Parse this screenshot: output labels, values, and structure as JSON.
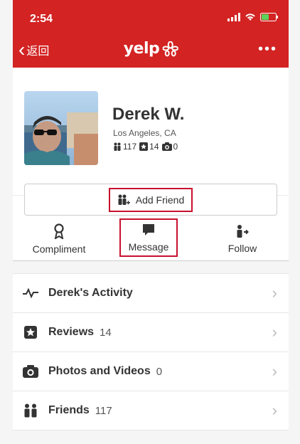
{
  "status": {
    "time": "2:54"
  },
  "nav": {
    "back_label": "返回",
    "logo_text": "yelp"
  },
  "profile": {
    "name": "Derek W.",
    "location": "Los Angeles, CA",
    "stats": {
      "friends": "117",
      "reviews": "14",
      "photos": "0"
    }
  },
  "actions": {
    "add_friend": "Add Friend",
    "compliment": "Compliment",
    "message": "Message",
    "follow": "Follow"
  },
  "list": [
    {
      "label": "Derek's Activity",
      "count": "",
      "icon": "activity-icon"
    },
    {
      "label": "Reviews",
      "count": "14",
      "icon": "star-icon"
    },
    {
      "label": "Photos and Videos",
      "count": "0",
      "icon": "camera-icon"
    },
    {
      "label": "Friends",
      "count": "117",
      "icon": "friends-icon"
    }
  ],
  "colors": {
    "brand": "#d32323",
    "highlight": "#c8102e"
  }
}
